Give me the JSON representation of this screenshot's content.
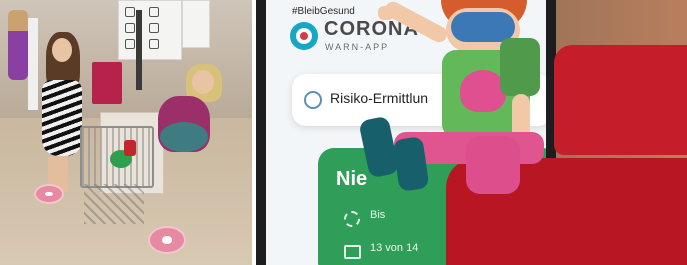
{
  "left_photo": {
    "description_free": true
  },
  "right_photo": {
    "app": {
      "hashtag": "#BleibGesund",
      "title": "CORONA",
      "subtitle": "WARN-APP",
      "risk_label": "Risiko-Ermittlun",
      "status_heading": "Nie",
      "line1": "Bis",
      "line2": "13 von 14"
    },
    "colors": {
      "app_green": "#2e9e58",
      "logo_blue": "#16a7c8",
      "logo_red": "#d63a4c",
      "bench_red": "#c51d2a"
    }
  }
}
